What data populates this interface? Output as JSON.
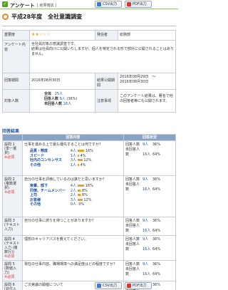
{
  "header": {
    "check_glyph": "✓",
    "title": "アンケート",
    "subtitle": "[ 結果確認 ]",
    "csv_label": "CSV出力",
    "pdf_label": "PDF出力"
  },
  "survey": {
    "title": "平成28年度　全社意識調査",
    "importance_label": "重要度",
    "stars": "★★☆☆☆",
    "owner_label": "発信者",
    "owner": "総務部",
    "info_label": "アンケート内容",
    "info_lines": [
      "全社員対象の意識調査です。",
      "結果は社員向けに公開いたしますが、個人を特定される形で部外に公開されることはありません。"
    ],
    "period_label": "回答期間",
    "period": "2016年08月30日",
    "publish_label": "結果公開期間",
    "publish_lines": [
      "2016年08月29日　～",
      "2016年08月30日"
    ],
    "target_label": "対象人数",
    "stats": [
      {
        "label": "全体",
        "value": "25人"
      },
      {
        "label": "回答人数",
        "value": "9人",
        "pct": "(36%)"
      },
      {
        "label": "未回答人数",
        "value": "16人"
      }
    ],
    "notes_label": "注意事項",
    "notes": "このアンケート結果は、著名で他の回答者等にも公開されます。"
  },
  "section_title": "回答結果",
  "table_headers": {
    "content": "回答内容",
    "status": "回答状況"
  },
  "questions": [
    {
      "label": "設問 1",
      "type": "(単一選択)",
      "required": "※必須",
      "text": "仕事を進める上で最も優先することは何ですか？",
      "choices": [
        {
          "name": "品質・精度",
          "count": "4人",
          "pct": "16%",
          "ratio": 0.16
        },
        {
          "name": "スピード",
          "count": "1人",
          "pct": "4%",
          "ratio": 0.04
        },
        {
          "name": "社内のコンセンサス",
          "count": "3人",
          "pct": "12%",
          "ratio": 0.12
        },
        {
          "name": "その他",
          "count": "1人",
          "pct": "4%",
          "ratio": 0.04
        }
      ],
      "answered": "回答人数",
      "answered_n": "9人",
      "answered_pct": "36%",
      "unanswered": "未回答人数",
      "unanswered_n": "16人",
      "unanswered_pct": "64%"
    },
    {
      "label": "設問 2",
      "type": "(複数選択)",
      "required": "※必須",
      "text": "自分の仕事を評価しているのは誰だと思いますか？",
      "choices": [
        {
          "name": "後輩、部下",
          "count": "4人",
          "pct": "16%",
          "ratio": 0.16
        },
        {
          "name": "同僚、チームメンバー",
          "count": "2人",
          "pct": "8%",
          "ratio": 0.08
        },
        {
          "name": "上司",
          "count": "2人",
          "pct": "8%",
          "ratio": 0.08
        },
        {
          "name": "お客様",
          "count": "3人",
          "pct": "12%",
          "ratio": 0.12
        },
        {
          "name": "その他",
          "count": "0人",
          "pct": "0%",
          "ratio": 0.0
        }
      ],
      "answered": "回答人数",
      "answered_n": "9人",
      "answered_pct": "36%",
      "unanswered": "未回答人数",
      "unanswered_n": "16人",
      "unanswered_pct": "64%"
    },
    {
      "label": "設問 3",
      "type": "(テキスト入力)",
      "required": "",
      "text": "自分の仕事に誇りを持つことがありますか？",
      "answered": "回答人数",
      "answered_n": "9人",
      "answered_pct": "36%",
      "unanswered": "未回答人数",
      "unanswered_n": "16人",
      "unanswered_pct": "64%"
    },
    {
      "label": "設問 4",
      "type": "(テキスト入力 (複数行))",
      "required": "※必須",
      "text": "理想のキャリアパスを教えてください。",
      "answered": "回答人数",
      "answered_n": "9人",
      "answered_pct": "36%",
      "unanswered": "未回答人数",
      "unanswered_n": "16人",
      "unanswered_pct": "64%"
    },
    {
      "label": "設問 5",
      "type": "(数値入力)",
      "required": "※必須",
      "text": "現在の仕事内容、職場環境への満足度はどの程度ですか？",
      "answered": "回答人数",
      "answered_n": "9人",
      "answered_pct": "36%",
      "unanswered": "未回答人数",
      "unanswered_n": "16人",
      "unanswered_pct": "64%"
    },
    {
      "label": "設問 6",
      "type": "(日付入力)",
      "required": "",
      "text": "ご次第議の開催について",
      "answered": "回答人数",
      "answered_n": "9人",
      "answered_pct": "36%",
      "unanswered": "未回答人数",
      "unanswered_n": "16人",
      "unanswered_pct": "64%"
    }
  ],
  "colors": {
    "accent": "#5aa02c",
    "header_blue": "#8aa3c4",
    "bar": "#f0a020",
    "link": "#1b4fa0",
    "required": "#dd3333"
  }
}
